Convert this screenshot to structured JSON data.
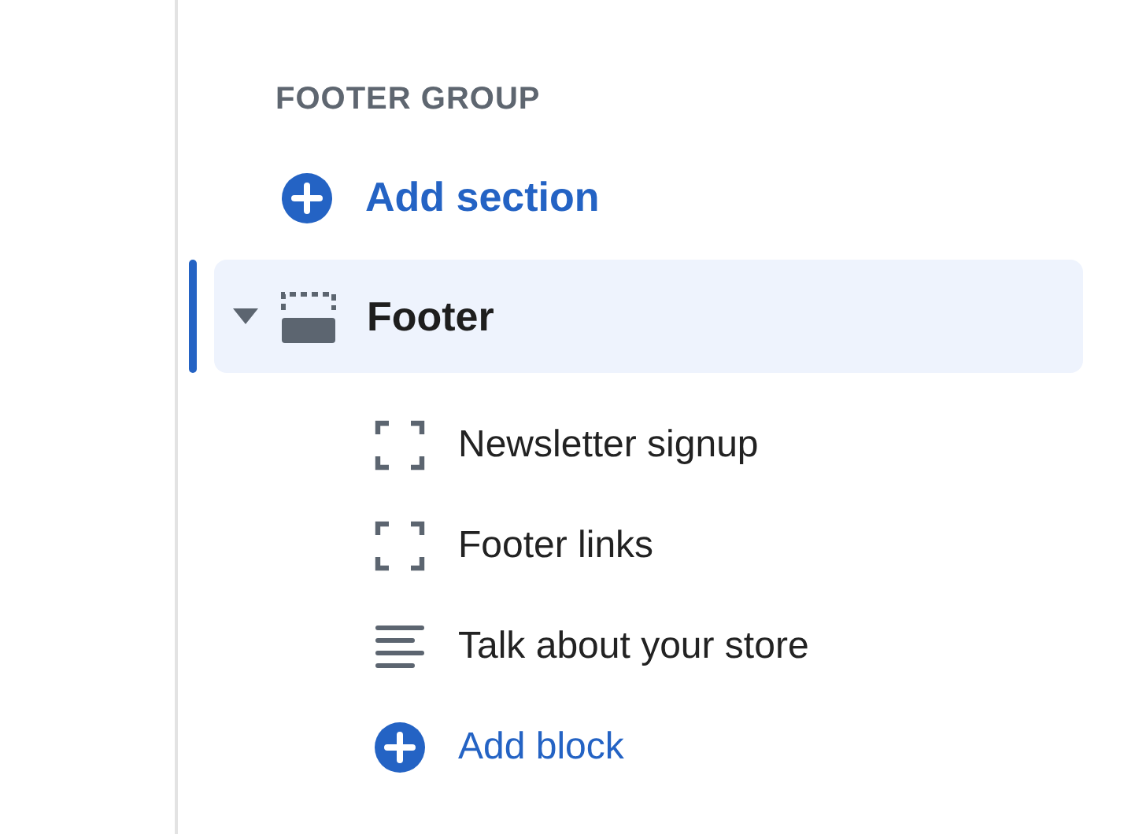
{
  "group_heading": "FOOTER GROUP",
  "add_section": "Add section",
  "section": {
    "label": "Footer",
    "expanded": true,
    "selected": true,
    "blocks": [
      {
        "label": "Newsletter signup",
        "kind": "placeholder"
      },
      {
        "label": "Footer links",
        "kind": "placeholder"
      },
      {
        "label": "Talk about your store",
        "kind": "text"
      }
    ],
    "add_block": "Add block"
  }
}
